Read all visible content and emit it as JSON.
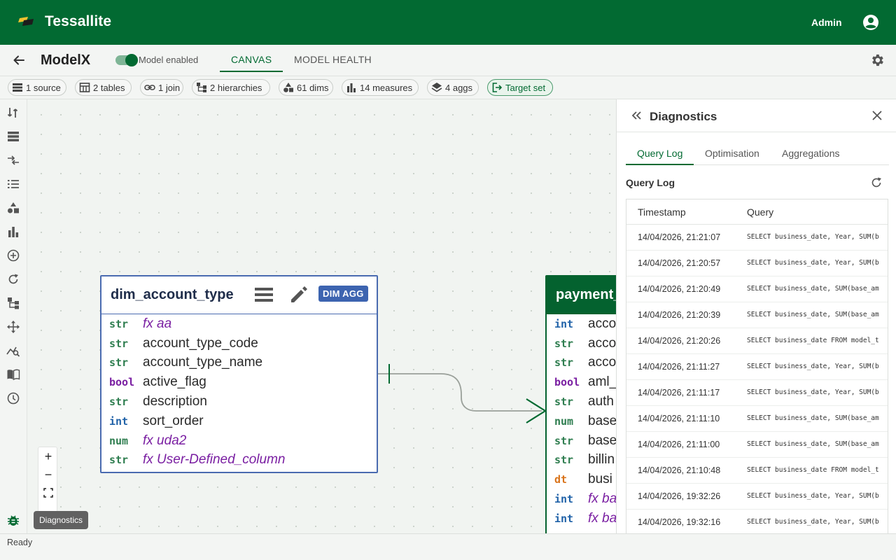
{
  "app": {
    "title": "Tessallite",
    "user": "Admin"
  },
  "model": {
    "name": "ModelX",
    "toggle_label": "Model enabled",
    "tabs": [
      {
        "label": "CANVAS",
        "active": true
      },
      {
        "label": "MODEL HEALTH",
        "active": false
      }
    ]
  },
  "chips": [
    {
      "icon": "sources-icon",
      "label": "1 source"
    },
    {
      "icon": "table-icon",
      "label": "2 tables"
    },
    {
      "icon": "link-icon",
      "label": "1 join"
    },
    {
      "icon": "hierarchy-icon",
      "label": "2 hierarchies"
    },
    {
      "icon": "shapes-icon",
      "label": "61 dims"
    },
    {
      "icon": "bar-chart-icon",
      "label": "14 measures"
    },
    {
      "icon": "layers-icon",
      "label": "4 aggs"
    },
    {
      "icon": "target-icon",
      "label": "Target set"
    }
  ],
  "canvas": {
    "table1": {
      "name": "dim_account_type",
      "badge": "DIM AGG",
      "columns": [
        {
          "type": "str",
          "name": "fx aa",
          "fx": true
        },
        {
          "type": "str",
          "name": "account_type_code",
          "fx": false
        },
        {
          "type": "str",
          "name": "account_type_name",
          "fx": false
        },
        {
          "type": "bool",
          "name": "active_flag",
          "fx": false
        },
        {
          "type": "str",
          "name": "description",
          "fx": false
        },
        {
          "type": "int",
          "name": "sort_order",
          "fx": false
        },
        {
          "type": "num",
          "name": "fx uda2",
          "fx": true
        },
        {
          "type": "str",
          "name": "fx User-Defined_column",
          "fx": true
        }
      ]
    },
    "table2": {
      "name": "payment_",
      "columns": [
        {
          "type": "int",
          "name": "acco",
          "fx": false
        },
        {
          "type": "str",
          "name": "acco",
          "fx": false
        },
        {
          "type": "str",
          "name": "acco",
          "fx": false
        },
        {
          "type": "bool",
          "name": "aml_",
          "fx": false
        },
        {
          "type": "str",
          "name": "auth",
          "fx": false
        },
        {
          "type": "num",
          "name": "base",
          "fx": false
        },
        {
          "type": "str",
          "name": "base",
          "fx": false
        },
        {
          "type": "str",
          "name": "billin",
          "fx": false
        },
        {
          "type": "dt",
          "name": "busi",
          "fx": false
        },
        {
          "type": "int",
          "name": "fx ba",
          "fx": true
        },
        {
          "type": "int",
          "name": "fx ba",
          "fx": true
        }
      ]
    },
    "zoom": {
      "in": "+",
      "out": "−"
    },
    "tooltip": "Diagnostics"
  },
  "diagnostics": {
    "title": "Diagnostics",
    "tabs": [
      {
        "label": "Query Log",
        "active": true
      },
      {
        "label": "Optimisation",
        "active": false
      },
      {
        "label": "Aggregations",
        "active": false
      }
    ],
    "section_title": "Query Log",
    "columns": [
      "Timestamp",
      "Query"
    ],
    "rows": [
      {
        "ts": "14/04/2026, 21:21:07",
        "query": "SELECT business_date, Year, SUM(b"
      },
      {
        "ts": "14/04/2026, 21:20:57",
        "query": "SELECT business_date, Year, SUM(b"
      },
      {
        "ts": "14/04/2026, 21:20:49",
        "query": "SELECT business_date, SUM(base_am"
      },
      {
        "ts": "14/04/2026, 21:20:39",
        "query": "SELECT business_date, SUM(base_am"
      },
      {
        "ts": "14/04/2026, 21:20:26",
        "query": "SELECT business_date FROM model_t"
      },
      {
        "ts": "14/04/2026, 21:11:27",
        "query": "SELECT business_date, Year, SUM(b"
      },
      {
        "ts": "14/04/2026, 21:11:17",
        "query": "SELECT business_date, Year, SUM(b"
      },
      {
        "ts": "14/04/2026, 21:11:10",
        "query": "SELECT business_date, SUM(base_am"
      },
      {
        "ts": "14/04/2026, 21:11:00",
        "query": "SELECT business_date, SUM(base_am"
      },
      {
        "ts": "14/04/2026, 21:10:48",
        "query": "SELECT business_date FROM model_t"
      },
      {
        "ts": "14/04/2026, 19:32:26",
        "query": "SELECT business_date, Year, SUM(b"
      },
      {
        "ts": "14/04/2026, 19:32:16",
        "query": "SELECT business_date, Year, SUM(b"
      }
    ]
  },
  "status": "Ready",
  "colors": {
    "brand": "#026a32",
    "dim_table": "#4a6bb0",
    "fact_table": "#04622f"
  }
}
